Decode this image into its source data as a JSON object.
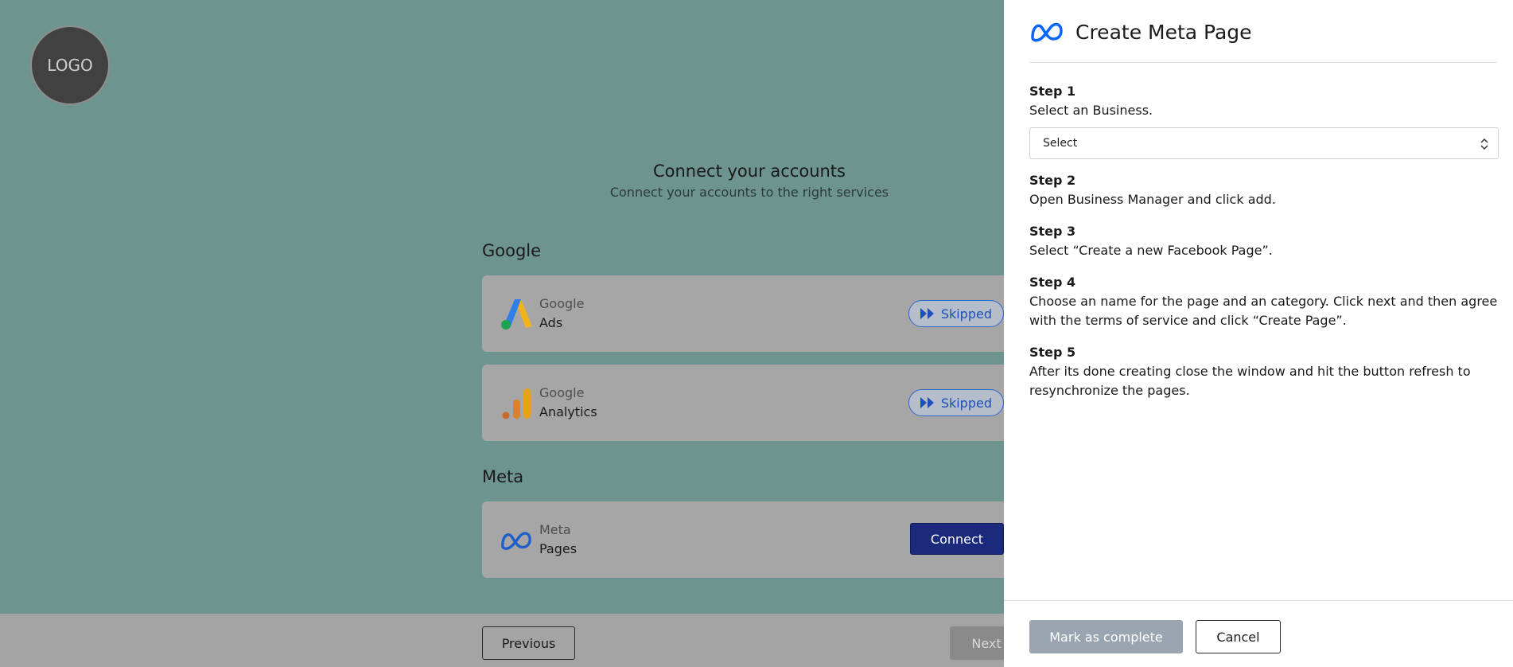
{
  "background": {
    "logo_text": "LOGO",
    "title": "Connect your accounts",
    "subtitle": "Connect your accounts to the right services",
    "sections": [
      {
        "label": "Google",
        "cards": [
          {
            "provider": "Google",
            "service": "Ads",
            "status": "Skipped",
            "icon": "google-ads-icon"
          },
          {
            "provider": "Google",
            "service": "Analytics",
            "status": "Skipped",
            "icon": "google-analytics-icon"
          }
        ]
      },
      {
        "label": "Meta",
        "cards": [
          {
            "provider": "Meta",
            "service": "Pages",
            "action": "Connect",
            "icon": "meta-icon"
          }
        ]
      }
    ],
    "footer": {
      "previous_label": "Previous",
      "next_label": "Next"
    }
  },
  "panel": {
    "title": "Create Meta Page",
    "icon": "meta-icon",
    "select": {
      "value": "Select"
    },
    "steps": [
      {
        "label": "Step 1",
        "text": "Select an Business."
      },
      {
        "label": "Step 2",
        "text": "Open Business Manager and click add."
      },
      {
        "label": "Step 3",
        "text": "Select “Create a new Facebook Page”."
      },
      {
        "label": "Step 4",
        "text": "Choose an name for the page and an category. Click next and then agree with the terms of service and click “Create Page”."
      },
      {
        "label": "Step 5",
        "text": "After its done creating close the window and hit the button refresh to resynchronize the pages."
      }
    ],
    "mark_complete_label": "Mark as complete",
    "cancel_label": "Cancel"
  },
  "colors": {
    "overlay": "#6e9490",
    "primary_button": "#1b2a7c",
    "skipped_accent": "#1d4fb8",
    "meta_blue": "#0866ff"
  }
}
